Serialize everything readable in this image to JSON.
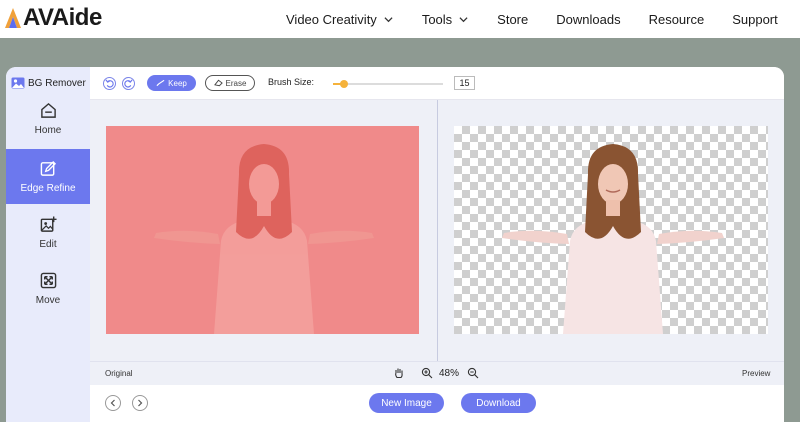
{
  "brand": {
    "name": "AVAide"
  },
  "nav": {
    "items": [
      {
        "label": "Video Creativity",
        "icon": "chevron-down-icon"
      },
      {
        "label": "Tools",
        "icon": "chevron-down-icon"
      },
      {
        "label": "Store"
      },
      {
        "label": "Downloads"
      },
      {
        "label": "Resource"
      },
      {
        "label": "Support"
      }
    ]
  },
  "app": {
    "title": "BG Remover",
    "sidebar": [
      {
        "label": "Home",
        "icon": "home-icon",
        "active": false
      },
      {
        "label": "Edge Refine",
        "icon": "edge-refine-icon",
        "active": true
      },
      {
        "label": "Edit",
        "icon": "edit-image-icon",
        "active": false
      },
      {
        "label": "Move",
        "icon": "move-icon",
        "active": false
      }
    ],
    "toolbar": {
      "keep_label": "Keep",
      "erase_label": "Erase",
      "brush_label": "Brush Size:",
      "brush_value": "15",
      "brush_level": 0.1
    },
    "labels": {
      "original": "Original",
      "preview": "Preview"
    },
    "zoom": "48%",
    "buttons": {
      "new_image": "New Image",
      "download": "Download"
    }
  },
  "colors": {
    "accent": "#6c78ee",
    "slider": "#f5b23b",
    "overlay": "#f08a8a",
    "sidebar_bg": "#e8ebfb"
  }
}
